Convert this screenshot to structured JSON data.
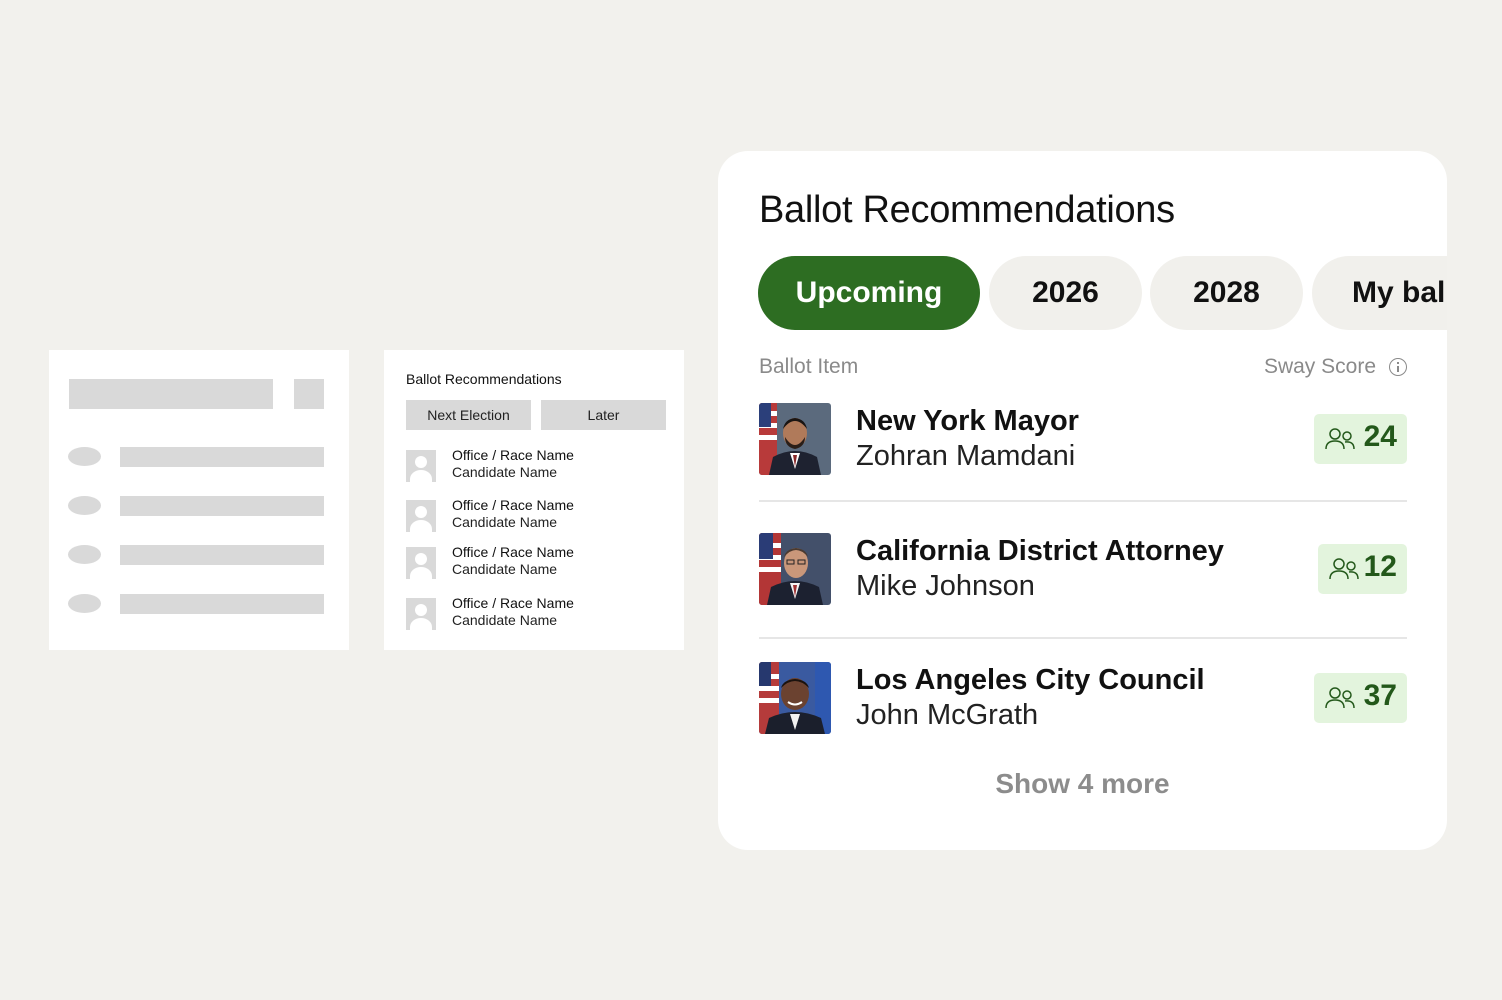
{
  "wireframe_list": {},
  "wireframe_ballot": {
    "title": "Ballot Recommendations",
    "tabs": [
      "Next Election",
      "Later"
    ],
    "rows": [
      {
        "office": "Office / Race Name",
        "candidate": "Candidate Name"
      },
      {
        "office": "Office / Race Name",
        "candidate": "Candidate Name"
      },
      {
        "office": "Office / Race Name",
        "candidate": "Candidate Name"
      },
      {
        "office": "Office / Race Name",
        "candidate": "Candidate Name"
      }
    ]
  },
  "ballot": {
    "title": "Ballot Recommendations",
    "tabs": [
      {
        "label": "Upcoming",
        "active": true
      },
      {
        "label": "2026",
        "active": false
      },
      {
        "label": "2028",
        "active": false
      },
      {
        "label": "My ball",
        "active": false
      }
    ],
    "columns": {
      "item": "Ballot Item",
      "score": "Sway Score"
    },
    "items": [
      {
        "office": "New York Mayor",
        "candidate": "Zohran Mamdani",
        "score": "24"
      },
      {
        "office": "California District Attorney",
        "candidate": "Mike Johnson",
        "score": "12"
      },
      {
        "office": "Los Angeles City Council",
        "candidate": "John McGrath",
        "score": "37"
      }
    ],
    "show_more": "Show 4 more",
    "colors": {
      "accent": "#2d6d22",
      "badge_bg": "#e3f4dd",
      "score_text": "#23581a"
    }
  }
}
